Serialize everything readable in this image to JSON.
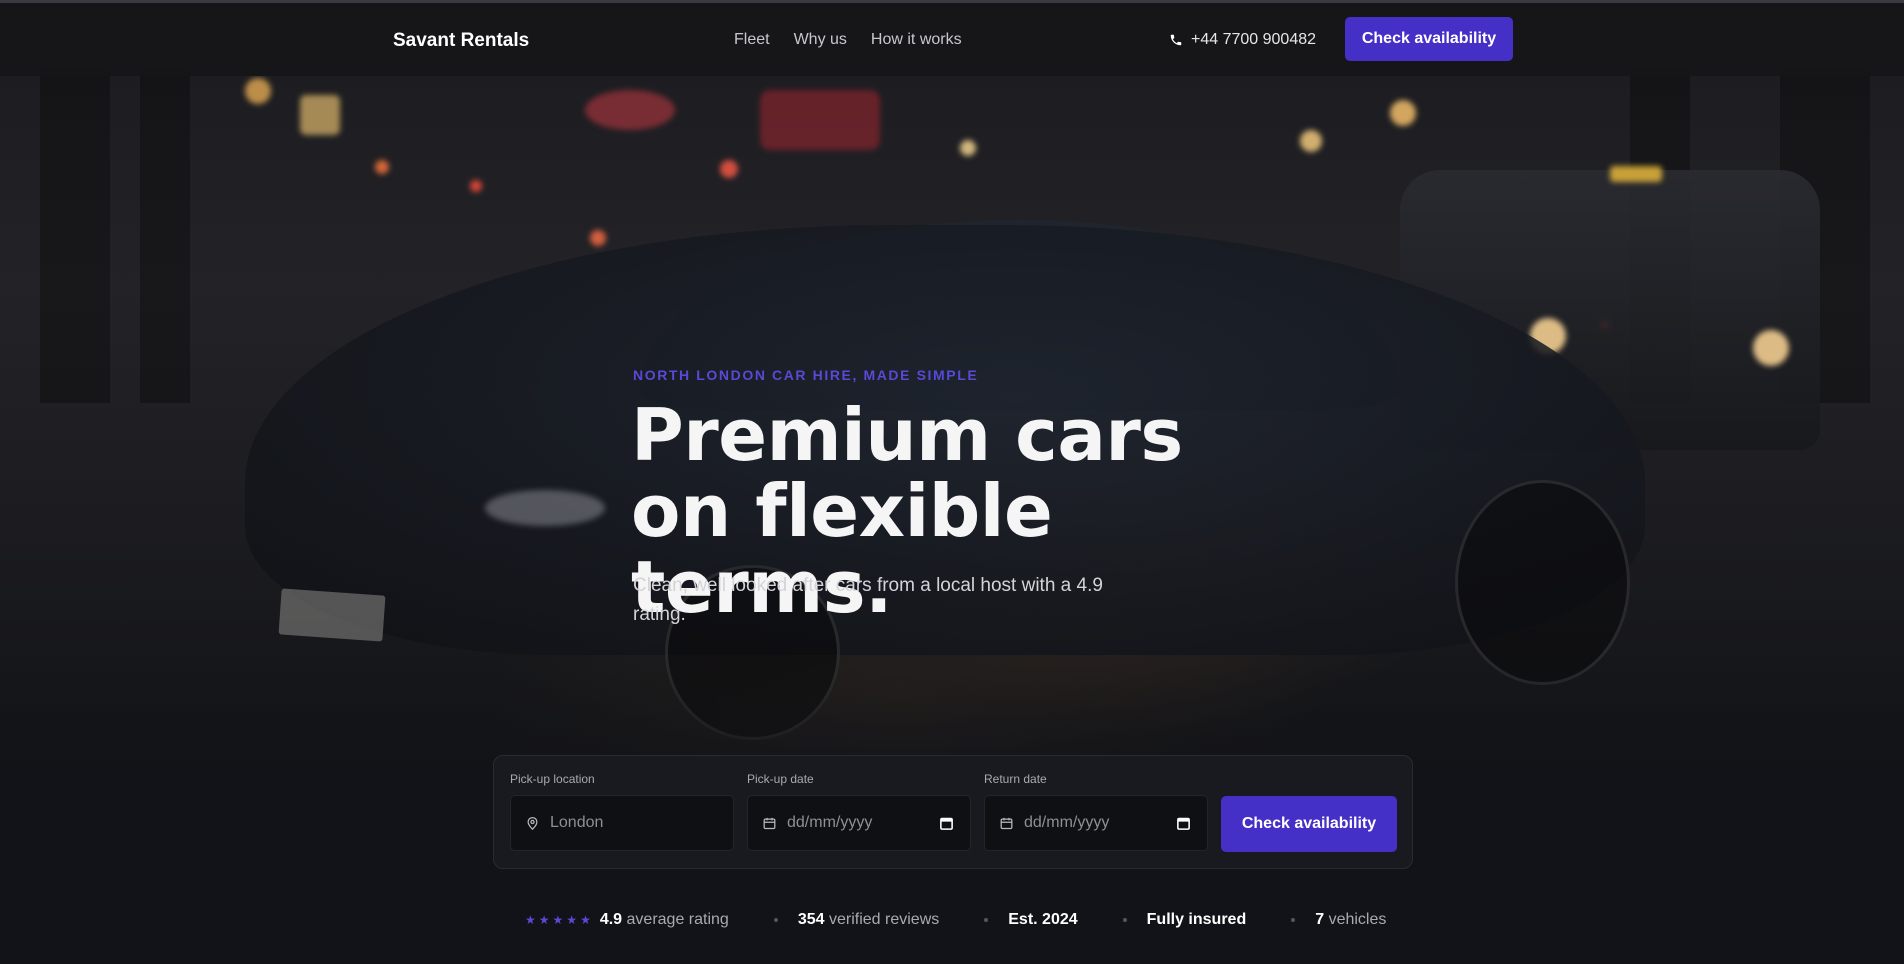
{
  "nav": {
    "brand": "Savant Rentals",
    "links": [
      "Fleet",
      "Why us",
      "How it works"
    ],
    "phone": "+44 7700 900482",
    "cta": "Check availability"
  },
  "hero": {
    "eyebrow": "NORTH LONDON CAR HIRE, MADE SIMPLE",
    "headline": "Premium cars on flexible terms.",
    "subtitle": "Clean, well looked after cars from a local host with a 4.9 rating."
  },
  "booking": {
    "pickup_location": {
      "label": "Pick-up location",
      "placeholder": "London",
      "icon": "map-pin-icon"
    },
    "pickup_date": {
      "label": "Pick-up date",
      "placeholder": "dd/mm/yyyy",
      "icon": "calendar-icon"
    },
    "return_date": {
      "label": "Return date",
      "placeholder": "dd/mm/yyyy",
      "icon": "calendar-icon"
    },
    "cta": "Check availability"
  },
  "stats": {
    "rating_stars": 5,
    "rating_value": "4.9",
    "rating_text": "average rating",
    "reviews_value": "354",
    "reviews_text": "verified reviews",
    "established": "Est. 2024",
    "insured": "Fully insured",
    "vehicles_value": "7",
    "vehicles_text": "vehicles"
  },
  "colors": {
    "accent": "#4430c7",
    "accent_text": "#5a49d6",
    "background": "#121318"
  }
}
